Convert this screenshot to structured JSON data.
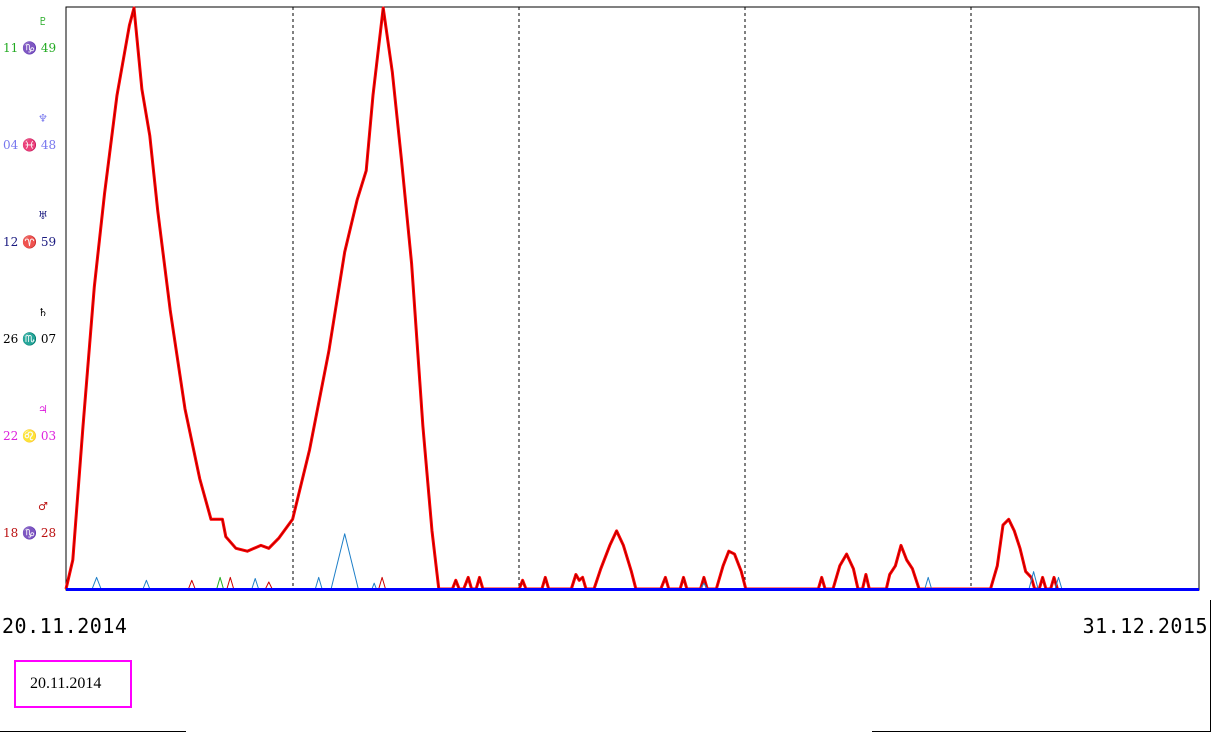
{
  "chart_data": {
    "type": "line",
    "x_start_label": "20.11.2014",
    "x_end_label": "31.12.2015",
    "current_date": "20.11.2014",
    "planet_rows": [
      {
        "glyph": "♇",
        "position": "11 ♑ 49",
        "color": "#22aa22"
      },
      {
        "glyph": "♆",
        "position": "04 ♓ 48",
        "color": "#7777ee"
      },
      {
        "glyph": "♅",
        "position": "12 ♈ 59",
        "color": "#1a1a80"
      },
      {
        "glyph": "♄",
        "position": "26 ♏ 07",
        "color": "#000000"
      },
      {
        "glyph": "♃",
        "position": "22 ♌ 03",
        "color": "#dd22dd"
      },
      {
        "glyph": "♂",
        "position": "18 ♑ 28",
        "color": "#bb1111"
      }
    ],
    "ylim": [
      0,
      1
    ],
    "xlim": [
      0,
      1
    ],
    "series": [
      {
        "color": "#ff0000",
        "points": [
          [
            0,
            0
          ],
          [
            0.006,
            0.05
          ],
          [
            0.015,
            0.28
          ],
          [
            0.025,
            0.52
          ],
          [
            0.034,
            0.68
          ],
          [
            0.045,
            0.85
          ],
          [
            0.056,
            0.97
          ],
          [
            0.06,
            1.0
          ],
          [
            0.067,
            0.86
          ],
          [
            0.074,
            0.78
          ],
          [
            0.081,
            0.65
          ],
          [
            0.092,
            0.48
          ],
          [
            0.105,
            0.31
          ],
          [
            0.118,
            0.19
          ],
          [
            0.128,
            0.12
          ],
          [
            0.135,
            0.12
          ],
          [
            0.138,
            0.12
          ],
          [
            0.141,
            0.09
          ],
          [
            0.15,
            0.07
          ],
          [
            0.16,
            0.065
          ],
          [
            0.172,
            0.075
          ],
          [
            0.179,
            0.07
          ],
          [
            0.188,
            0.088
          ],
          [
            0.2,
            0.12
          ],
          [
            0.215,
            0.24
          ],
          [
            0.232,
            0.41
          ],
          [
            0.246,
            0.58
          ],
          [
            0.257,
            0.67
          ],
          [
            0.265,
            0.72
          ],
          [
            0.271,
            0.85
          ],
          [
            0.28,
            1.0
          ],
          [
            0.288,
            0.89
          ],
          [
            0.296,
            0.74
          ],
          [
            0.305,
            0.56
          ],
          [
            0.315,
            0.28
          ],
          [
            0.323,
            0.1
          ],
          [
            0.329,
            0
          ],
          [
            0.341,
            0
          ],
          [
            0.344,
            0.015
          ],
          [
            0.347,
            0
          ],
          [
            0.351,
            0
          ],
          [
            0.355,
            0.02
          ],
          [
            0.358,
            0
          ],
          [
            0.362,
            0
          ],
          [
            0.365,
            0.02
          ],
          [
            0.368,
            0
          ],
          [
            0.4,
            0
          ],
          [
            0.403,
            0.015
          ],
          [
            0.406,
            0
          ],
          [
            0.42,
            0
          ],
          [
            0.423,
            0.02
          ],
          [
            0.426,
            0
          ],
          [
            0.446,
            0
          ],
          [
            0.45,
            0.025
          ],
          [
            0.453,
            0.015
          ],
          [
            0.456,
            0.02
          ],
          [
            0.459,
            0
          ],
          [
            0.466,
            0
          ],
          [
            0.472,
            0.035
          ],
          [
            0.48,
            0.075
          ],
          [
            0.486,
            0.1
          ],
          [
            0.492,
            0.075
          ],
          [
            0.499,
            0.03
          ],
          [
            0.503,
            0
          ],
          [
            0.525,
            0
          ],
          [
            0.529,
            0.02
          ],
          [
            0.532,
            0
          ],
          [
            0.542,
            0
          ],
          [
            0.545,
            0.02
          ],
          [
            0.548,
            0
          ],
          [
            0.56,
            0
          ],
          [
            0.563,
            0.02
          ],
          [
            0.566,
            0
          ],
          [
            0.574,
            0
          ],
          [
            0.58,
            0.04
          ],
          [
            0.585,
            0.065
          ],
          [
            0.59,
            0.06
          ],
          [
            0.596,
            0.03
          ],
          [
            0.6,
            0
          ],
          [
            0.664,
            0
          ],
          [
            0.667,
            0.02
          ],
          [
            0.67,
            0
          ],
          [
            0.677,
            0
          ],
          [
            0.683,
            0.04
          ],
          [
            0.689,
            0.06
          ],
          [
            0.695,
            0.035
          ],
          [
            0.699,
            0
          ],
          [
            0.703,
            0
          ],
          [
            0.706,
            0.025
          ],
          [
            0.709,
            0
          ],
          [
            0.724,
            0
          ],
          [
            0.727,
            0.025
          ],
          [
            0.732,
            0.04
          ],
          [
            0.737,
            0.075
          ],
          [
            0.742,
            0.05
          ],
          [
            0.747,
            0.035
          ],
          [
            0.753,
            0
          ],
          [
            0.816,
            0
          ],
          [
            0.822,
            0.04
          ],
          [
            0.827,
            0.11
          ],
          [
            0.832,
            0.12
          ],
          [
            0.837,
            0.1
          ],
          [
            0.842,
            0.07
          ],
          [
            0.847,
            0.03
          ],
          [
            0.852,
            0.02
          ],
          [
            0.855,
            0
          ],
          [
            0.859,
            0
          ],
          [
            0.862,
            0.02
          ],
          [
            0.865,
            0
          ],
          [
            0.869,
            0
          ],
          [
            0.872,
            0.02
          ],
          [
            0.875,
            0
          ]
        ]
      },
      {
        "color": "#1e7fc8",
        "points": [
          [
            0.023,
            0
          ],
          [
            0.027,
            0.02
          ],
          [
            0.031,
            0
          ],
          [
            0.068,
            0
          ],
          [
            0.071,
            0.015
          ],
          [
            0.074,
            0
          ],
          [
            0.164,
            0
          ],
          [
            0.167,
            0.018
          ],
          [
            0.17,
            0
          ],
          [
            0.22,
            0
          ],
          [
            0.223,
            0.02
          ],
          [
            0.226,
            0
          ],
          [
            0.234,
            0
          ],
          [
            0.246,
            0.095
          ],
          [
            0.258,
            0
          ],
          [
            0.27,
            0
          ],
          [
            0.272,
            0.01
          ],
          [
            0.274,
            0
          ],
          [
            0.56,
            0
          ],
          [
            0.563,
            0.01
          ],
          [
            0.566,
            0
          ],
          [
            0.758,
            0
          ],
          [
            0.761,
            0.02
          ],
          [
            0.764,
            0
          ],
          [
            0.85,
            0
          ],
          [
            0.854,
            0.03
          ],
          [
            0.858,
            0
          ],
          [
            0.873,
            0
          ],
          [
            0.876,
            0.02
          ],
          [
            0.879,
            0
          ]
        ]
      },
      {
        "color": "#cc0000",
        "points": [
          [
            0.108,
            0
          ],
          [
            0.111,
            0.015
          ],
          [
            0.114,
            0
          ],
          [
            0.142,
            0
          ],
          [
            0.145,
            0.02
          ],
          [
            0.148,
            0
          ],
          [
            0.176,
            0
          ],
          [
            0.179,
            0.012
          ],
          [
            0.182,
            0
          ],
          [
            0.276,
            0
          ],
          [
            0.279,
            0.02
          ],
          [
            0.282,
            0
          ]
        ]
      },
      {
        "color": "#22aa22",
        "points": [
          [
            0.133,
            0
          ],
          [
            0.136,
            0.02
          ],
          [
            0.139,
            0
          ]
        ]
      }
    ]
  },
  "colors": {
    "baseline": "#0000ff",
    "current_date_border": "#ff00ff"
  }
}
